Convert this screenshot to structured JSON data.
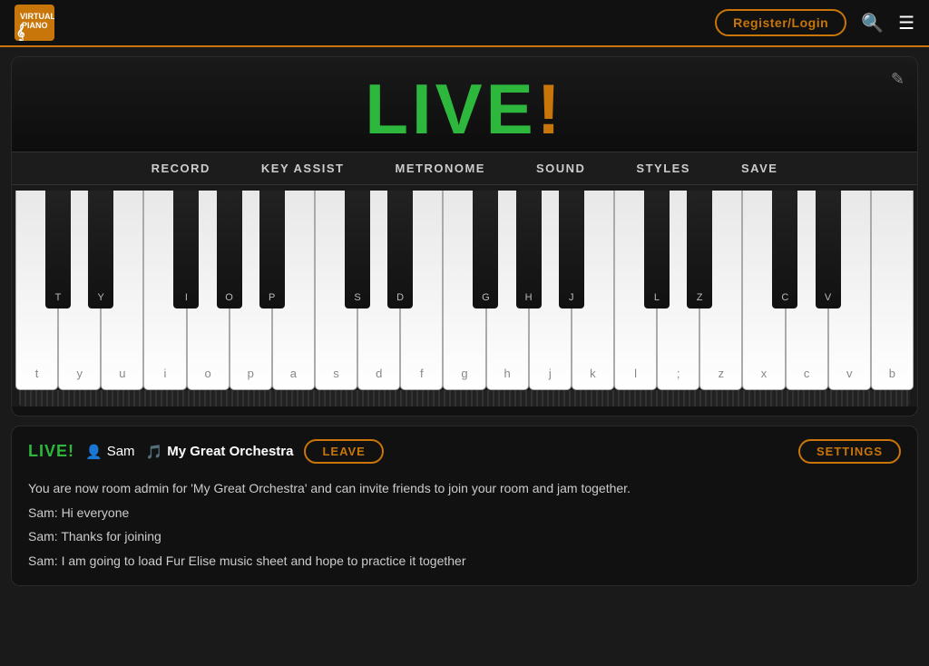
{
  "header": {
    "title": "Virtual Piano",
    "register_label": "Register/Login"
  },
  "live_banner": {
    "title": "LIVE!",
    "edit_icon": "✎"
  },
  "toolbar": {
    "buttons": [
      {
        "label": "RECORD",
        "id": "record"
      },
      {
        "label": "KEY ASSIST",
        "id": "key-assist"
      },
      {
        "label": "METRONOME",
        "id": "metronome"
      },
      {
        "label": "SOUND",
        "id": "sound"
      },
      {
        "label": "STYLES",
        "id": "styles"
      },
      {
        "label": "SAVE",
        "id": "save"
      }
    ]
  },
  "piano": {
    "white_keys": [
      {
        "label": "t"
      },
      {
        "label": "y"
      },
      {
        "label": "u"
      },
      {
        "label": "i"
      },
      {
        "label": "o"
      },
      {
        "label": "p"
      },
      {
        "label": "a"
      },
      {
        "label": "s"
      },
      {
        "label": "d"
      },
      {
        "label": "f"
      },
      {
        "label": "g"
      },
      {
        "label": "h"
      },
      {
        "label": "j"
      },
      {
        "label": "k"
      },
      {
        "label": "l"
      },
      {
        "label": ";"
      },
      {
        "label": "z"
      },
      {
        "label": "x"
      },
      {
        "label": "c"
      },
      {
        "label": "v"
      },
      {
        "label": "b"
      }
    ],
    "black_keys": [
      {
        "label": "T",
        "offset": 1
      },
      {
        "label": "Y",
        "offset": 2
      },
      {
        "label": "I",
        "offset": 4
      },
      {
        "label": "O",
        "offset": 5
      },
      {
        "label": "P",
        "offset": 6
      },
      {
        "label": "S",
        "offset": 8
      },
      {
        "label": "D",
        "offset": 9
      },
      {
        "label": "G",
        "offset": 11
      },
      {
        "label": "H",
        "offset": 12
      },
      {
        "label": "J",
        "offset": 13
      },
      {
        "label": "L",
        "offset": 15
      },
      {
        "label": "Z",
        "offset": 16
      },
      {
        "label": "C",
        "offset": 18
      },
      {
        "label": "V",
        "offset": 19
      }
    ]
  },
  "chat": {
    "live_label": "LIVE!",
    "user_label": "Sam",
    "orchestra_label": "My Great Orchestra",
    "leave_label": "LEAVE",
    "settings_label": "SETTINGS",
    "messages": [
      "You are now room admin for 'My Great Orchestra' and can invite friends to join your room and jam together.",
      "Sam: Hi everyone",
      "Sam: Thanks for joining",
      "Sam: I am going to load Fur Elise music sheet and hope to practice it together"
    ]
  }
}
